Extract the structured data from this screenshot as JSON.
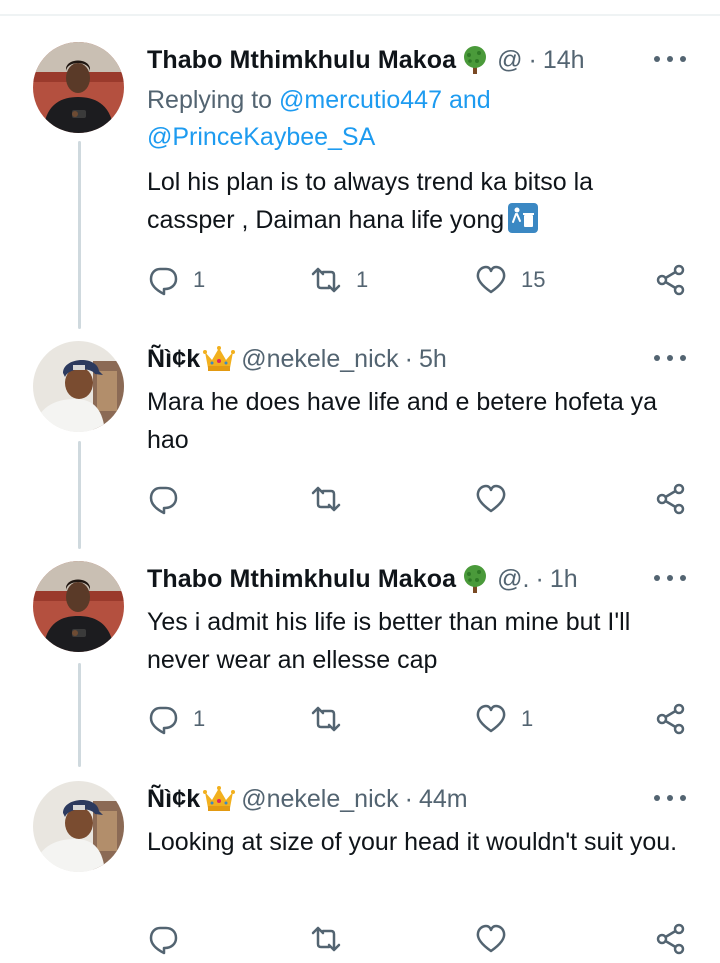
{
  "tweets": [
    {
      "name": "Thabo Mthimkhulu Makoa",
      "handle": "@",
      "time": "14h",
      "replying_prefix": "Replying to",
      "replying_mentions": [
        "@mercutio447",
        "@PrinceKaybee_SA"
      ],
      "replying_and": "and",
      "text": "Lol his plan is to always trend ka bitso la cassper , Daiman hana life yong",
      "replies": "1",
      "retweets": "1",
      "likes": "15"
    },
    {
      "name": "Ñì¢k",
      "handle": "@nekele_nick",
      "time": "5h",
      "text": "Mara he does have life and e betere hofeta ya hao",
      "replies": "",
      "retweets": "",
      "likes": ""
    },
    {
      "name": "Thabo Mthimkhulu Makoa",
      "handle": "@.",
      "time": "1h",
      "text": "Yes i admit his life is better than mine but I'll never wear an ellesse cap",
      "replies": "1",
      "retweets": "",
      "likes": "1"
    },
    {
      "name": "Ñì¢k",
      "handle": "@nekele_nick",
      "time": "44m",
      "text": "Looking at size of your head it wouldn't suit you.",
      "replies": "",
      "retweets": "",
      "likes": ""
    }
  ],
  "separator": "·",
  "colors": {
    "text": "#0f1419",
    "secondary": "#536471",
    "link": "#1d9bf0",
    "thread_line": "#cfd9de"
  },
  "icons": [
    "tree-emoji-icon",
    "crown-emoji-icon",
    "trash-sticker-icon",
    "more-icon",
    "reply-icon",
    "retweet-icon",
    "like-icon",
    "share-icon"
  ]
}
